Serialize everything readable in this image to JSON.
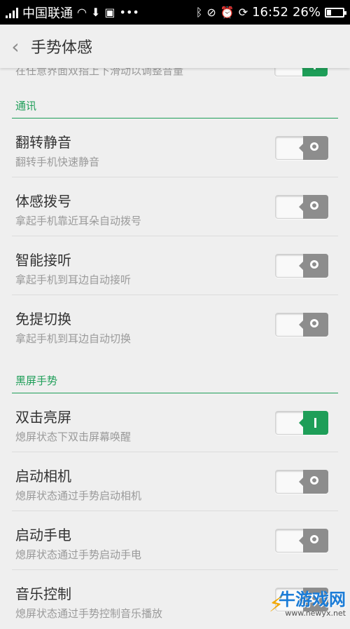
{
  "status_bar": {
    "carrier": "中国联通",
    "time": "16:52",
    "battery_percent": "26%",
    "battery_level": 0.26
  },
  "header": {
    "title": "手势体感"
  },
  "partial_row": {
    "subtitle": "在任意界面双指上下滑动以调整音量",
    "enabled": true
  },
  "sections": [
    {
      "title": "通讯",
      "rows": [
        {
          "title": "翻转静音",
          "subtitle": "翻转手机快速静音",
          "enabled": false
        },
        {
          "title": "体感拨号",
          "subtitle": "拿起手机靠近耳朵自动拨号",
          "enabled": false
        },
        {
          "title": "智能接听",
          "subtitle": "拿起手机到耳边自动接听",
          "enabled": false
        },
        {
          "title": "免提切换",
          "subtitle": "拿起手机到耳边自动切换",
          "enabled": false
        }
      ]
    },
    {
      "title": "黑屏手势",
      "rows": [
        {
          "title": "双击亮屏",
          "subtitle": "熄屏状态下双击屏幕唤醒",
          "enabled": true
        },
        {
          "title": "启动相机",
          "subtitle": "熄屏状态通过手势启动相机",
          "enabled": false
        },
        {
          "title": "启动手电",
          "subtitle": "熄屏状态通过手势启动手电",
          "enabled": false
        },
        {
          "title": "音乐控制",
          "subtitle": "熄屏状态通过手势控制音乐播放",
          "enabled": false
        }
      ]
    }
  ],
  "watermark": {
    "logo": "牛游戏网",
    "url": "www.newyx.net"
  },
  "colors": {
    "accent": "#1e9e58",
    "toggle_off": "#8d8d8d",
    "background": "#efefef"
  }
}
